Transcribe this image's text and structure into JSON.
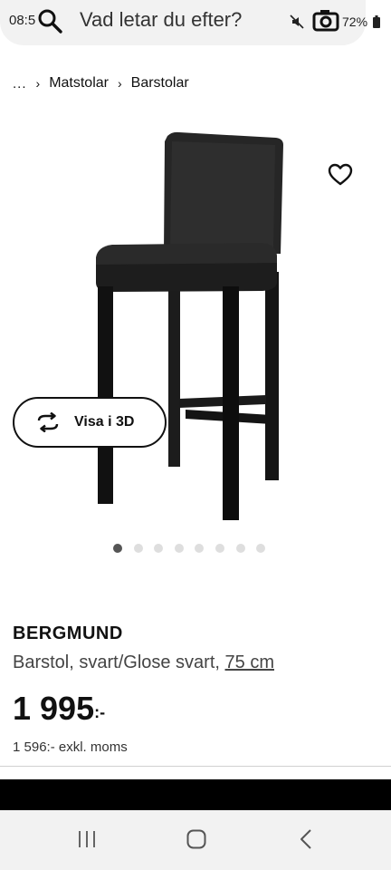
{
  "status_bar": {
    "time": "08:5",
    "battery": "72%"
  },
  "search": {
    "placeholder": "Vad letar du efter?"
  },
  "breadcrumb": {
    "ellipsis": "...",
    "items": [
      "Matstolar",
      "Barstolar"
    ]
  },
  "view3d": {
    "label": "Visa i 3D"
  },
  "carousel": {
    "total": 8,
    "active_index": 0
  },
  "product": {
    "name": "BERGMUND",
    "description": "Barstol, svart/Glose svart, ",
    "size": "75 cm",
    "price_main": "1 995",
    "price_suffix": ":-",
    "price_ex_vat": "1 596:- exkl. moms"
  },
  "icons": {
    "search": "search-icon",
    "mute": "mute-icon",
    "camera": "camera-icon",
    "battery": "battery-icon",
    "favorite": "heart-icon",
    "view3d": "rotate-icon",
    "nav_recent": "recent-apps-icon",
    "nav_home": "home-icon",
    "nav_back": "back-icon"
  }
}
